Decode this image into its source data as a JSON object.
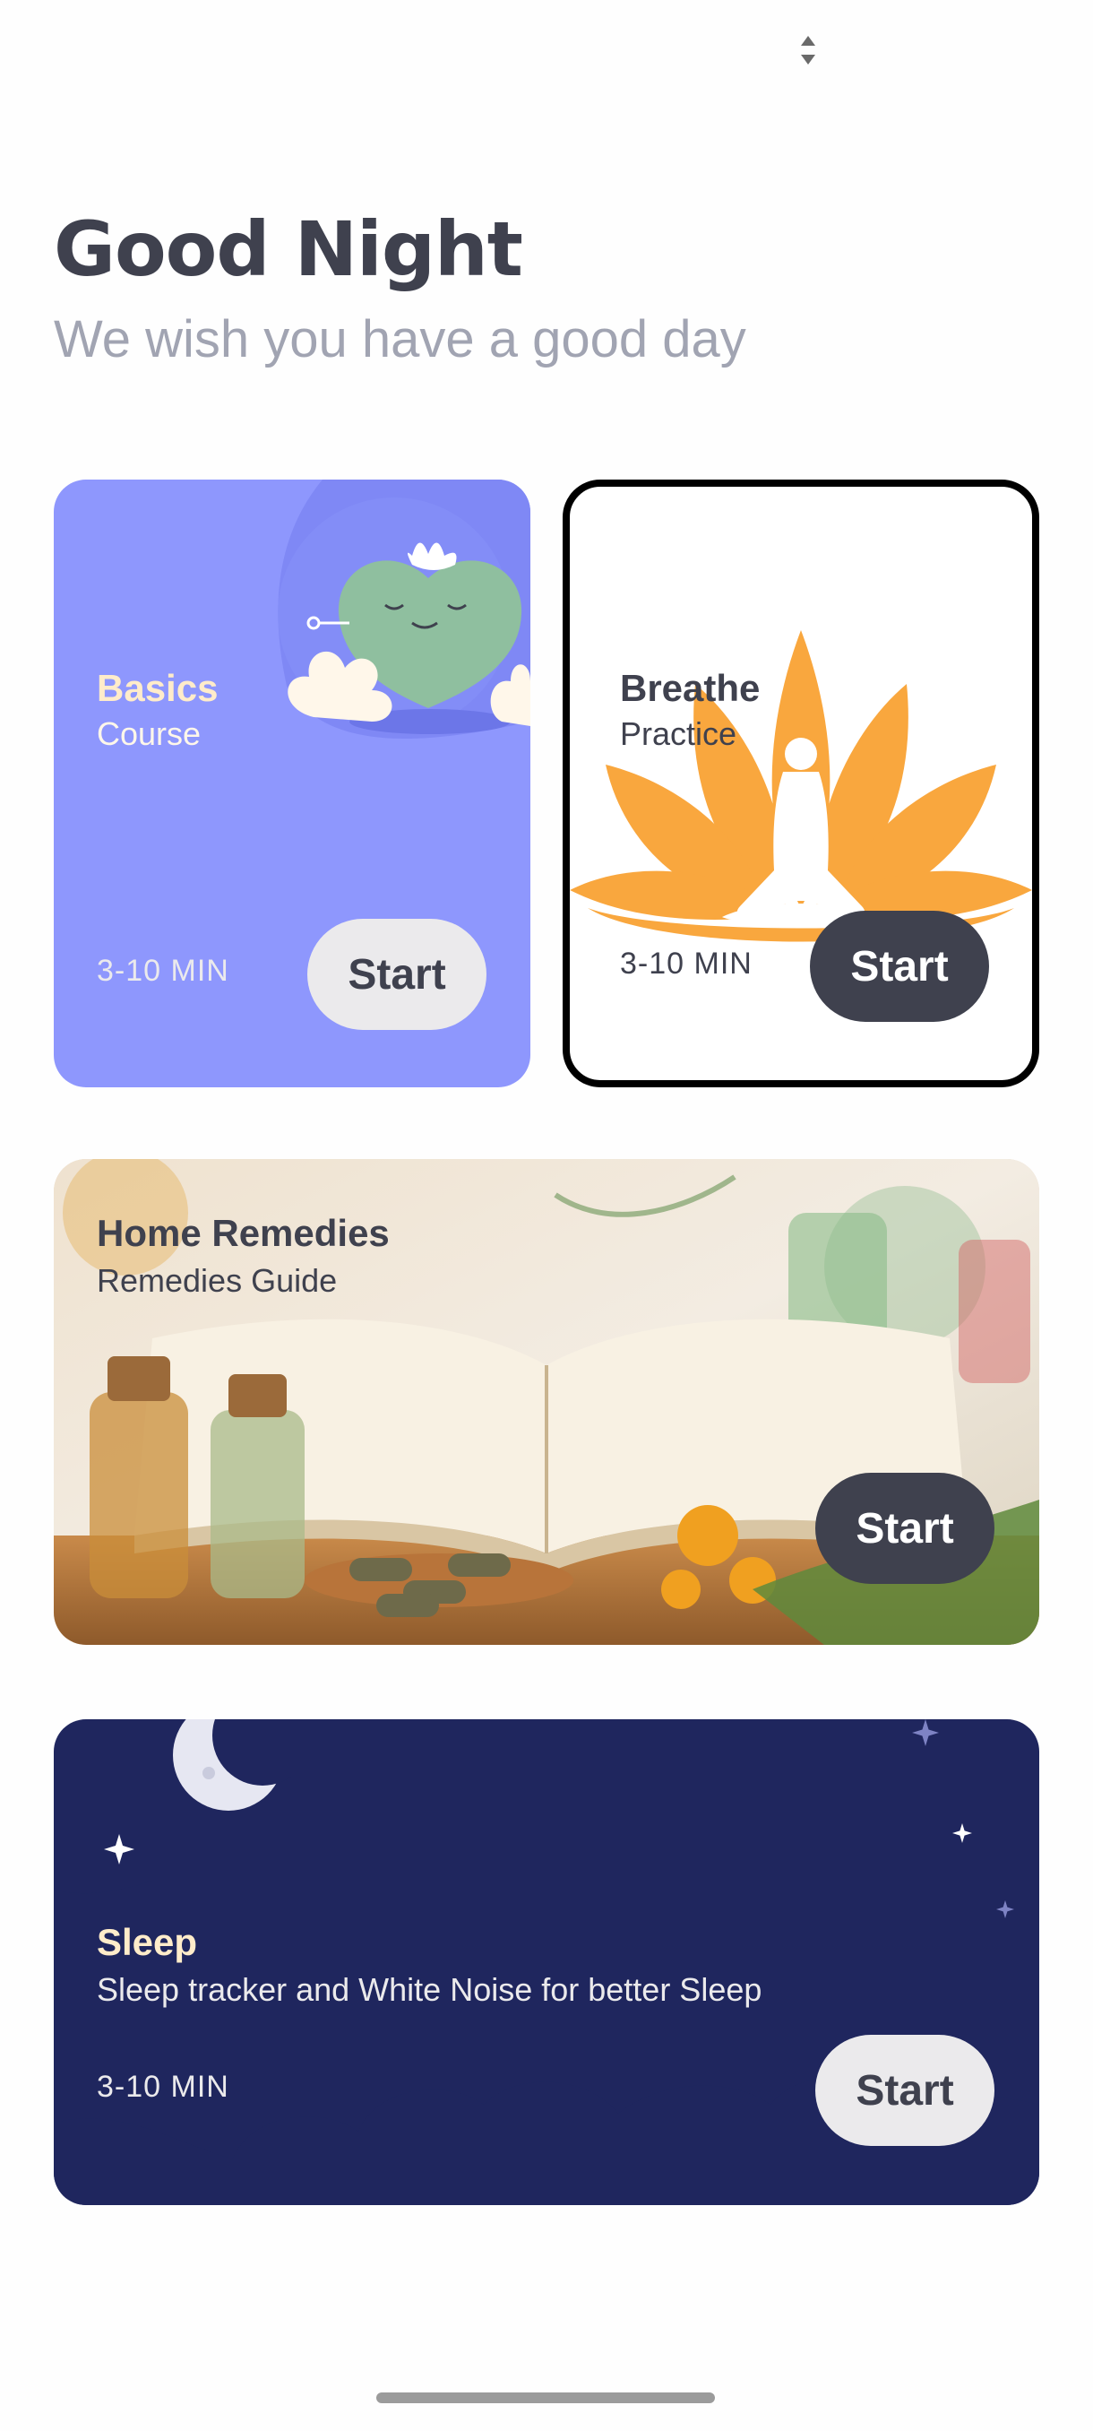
{
  "greeting": {
    "title": "Good Night",
    "subtitle": "We wish you have a good day"
  },
  "cards": {
    "basics": {
      "title": "Basics",
      "subtitle": "Course",
      "duration": "3-10 MIN",
      "button": "Start",
      "color": "#8e97fd"
    },
    "breathe": {
      "title": "Breathe",
      "subtitle": "Practice",
      "duration": "3-10 MIN",
      "button": "Start",
      "color": "#ffffff"
    },
    "remedies": {
      "title": "Home Remedies",
      "subtitle": "Remedies Guide",
      "button": "Start"
    },
    "sleep": {
      "title": "Sleep",
      "subtitle": "Sleep tracker and White Noise for better Sleep",
      "duration": "3-10 MIN",
      "button": "Start",
      "color": "#1f265e"
    }
  },
  "icons": [
    "sort-arrows-icon",
    "meditating-heart-illustration",
    "lotus-meditation-illustration",
    "moon-icon",
    "star-icon",
    "cloud-illustration"
  ],
  "colors": {
    "title_text": "#3f414e",
    "subtitle_text": "#a1a4b2",
    "accent_orange": "#f9a73e",
    "sleep_title": "#ffecca"
  }
}
